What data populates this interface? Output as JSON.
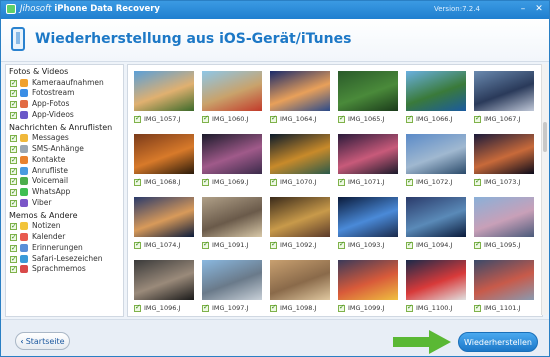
{
  "app": {
    "brand": "Jihosoft",
    "title": "iPhone Data Recovery",
    "version": "Version:7.2.4",
    "window_controls": [
      "minimize-icon",
      "close-icon"
    ]
  },
  "header": {
    "title": "Wiederherstellung aus iOS-Gerät/iTunes",
    "icon": "phone-icon"
  },
  "sidebar": {
    "sections": [
      {
        "label": "Fotos & Videos",
        "items": [
          {
            "label": "Kameraaufnahmen",
            "icon": "camera-roll-icon",
            "color": "#f0a12e"
          },
          {
            "label": "Fotostream",
            "icon": "photostream-icon",
            "color": "#3a8ee6"
          },
          {
            "label": "App-Fotos",
            "icon": "app-photos-icon",
            "color": "#e26b43"
          },
          {
            "label": "App-Videos",
            "icon": "app-videos-icon",
            "color": "#6a58c8"
          }
        ]
      },
      {
        "label": "Nachrichten & Anruflisten",
        "items": [
          {
            "label": "Messages",
            "icon": "messages-icon",
            "color": "#f0b83a"
          },
          {
            "label": "SMS-Anhänge",
            "icon": "sms-attachments-icon",
            "color": "#9aa6b2"
          },
          {
            "label": "Kontakte",
            "icon": "contacts-icon",
            "color": "#e8822f"
          },
          {
            "label": "Anrufliste",
            "icon": "call-log-icon",
            "color": "#4a9be0"
          },
          {
            "label": "Voicemail",
            "icon": "voicemail-icon",
            "color": "#4cae4c"
          },
          {
            "label": "WhatsApp",
            "icon": "whatsapp-icon",
            "color": "#3fbf52"
          },
          {
            "label": "Viber",
            "icon": "viber-icon",
            "color": "#7b57c8"
          }
        ]
      },
      {
        "label": "Memos & Andere",
        "items": [
          {
            "label": "Notizen",
            "icon": "notes-icon",
            "color": "#f2c43a"
          },
          {
            "label": "Kalender",
            "icon": "calendar-icon",
            "color": "#e85a4f"
          },
          {
            "label": "Erinnerungen",
            "icon": "reminders-icon",
            "color": "#5a8fd8"
          },
          {
            "label": "Safari-Lesezeichen",
            "icon": "safari-bookmarks-icon",
            "color": "#3a9ad8"
          },
          {
            "label": "Sprachmemos",
            "icon": "voice-memos-icon",
            "color": "#d84a4a"
          }
        ]
      }
    ]
  },
  "photos": [
    {
      "name": "IMG_1057.J",
      "colors": [
        "#5a9fd8",
        "#e0b070",
        "#3b6a2a"
      ]
    },
    {
      "name": "IMG_1060.J",
      "colors": [
        "#8ec7e8",
        "#c9a26b",
        "#c23a2a"
      ]
    },
    {
      "name": "IMG_1064.J",
      "colors": [
        "#1a2a6a",
        "#e8a05a",
        "#2a4a8a"
      ]
    },
    {
      "name": "IMG_1065.J",
      "colors": [
        "#2a5a2a",
        "#4a8a3a",
        "#1a3a1a"
      ]
    },
    {
      "name": "IMG_1066.J",
      "colors": [
        "#6ab0e0",
        "#3a7a3a",
        "#1a5aa0"
      ]
    },
    {
      "name": "IMG_1067.J",
      "colors": [
        "#6a8ab0",
        "#2a3a5a",
        "#c0c8d8"
      ]
    },
    {
      "name": "IMG_1068.J",
      "colors": [
        "#7a3a1a",
        "#d87a2a",
        "#2a1a0a"
      ]
    },
    {
      "name": "IMG_1069.J",
      "colors": [
        "#1a1a2a",
        "#a05a8a",
        "#3a2a4a"
      ]
    },
    {
      "name": "IMG_1070.J",
      "colors": [
        "#0a1a2a",
        "#c88a2a",
        "#2a5a4a"
      ]
    },
    {
      "name": "IMG_1071.J",
      "colors": [
        "#2a1a3a",
        "#c85a7a",
        "#1a1a2a"
      ]
    },
    {
      "name": "IMG_1072.J",
      "colors": [
        "#5a8ac8",
        "#a0b8d0",
        "#2a4a6a"
      ]
    },
    {
      "name": "IMG_1073.J",
      "colors": [
        "#1a1a3a",
        "#c86a3a",
        "#0a0a1a"
      ]
    },
    {
      "name": "IMG_1074.J",
      "colors": [
        "#2a3a6a",
        "#d89a5a",
        "#0a1a3a"
      ]
    },
    {
      "name": "IMG_1091.J",
      "colors": [
        "#b0a088",
        "#6a5a4a",
        "#d8c8a8"
      ]
    },
    {
      "name": "IMG_1092.J",
      "colors": [
        "#3a2a1a",
        "#c89a4a",
        "#5a3a2a"
      ]
    },
    {
      "name": "IMG_1093.J",
      "colors": [
        "#0a1a3a",
        "#4a8ad8",
        "#1a2a4a"
      ]
    },
    {
      "name": "IMG_1094.J",
      "colors": [
        "#2a3a6a",
        "#5a8ab8",
        "#0a1a3a"
      ]
    },
    {
      "name": "IMG_1095.J",
      "colors": [
        "#8ab0d8",
        "#c8a0b8",
        "#4a5a7a"
      ]
    },
    {
      "name": "IMG_1096.J",
      "colors": [
        "#3a3a3a",
        "#9a8a7a",
        "#1a1a1a"
      ]
    },
    {
      "name": "IMG_1097.J",
      "colors": [
        "#8ab8e0",
        "#6a7a8a",
        "#c8d0d8"
      ]
    },
    {
      "name": "IMG_1098.J",
      "colors": [
        "#c8a070",
        "#8a6a4a",
        "#e0c8a0"
      ]
    },
    {
      "name": "IMG_1099.J",
      "colors": [
        "#3a3a5a",
        "#d85a3a",
        "#f0c040"
      ]
    },
    {
      "name": "IMG_1100.J",
      "colors": [
        "#1a2a4a",
        "#d83a3a",
        "#e0e0e0"
      ]
    },
    {
      "name": "IMG_1101.J",
      "colors": [
        "#3a4a6a",
        "#c85a4a",
        "#8a9ab0"
      ]
    }
  ],
  "footer": {
    "back_label": "Startseite",
    "recover_label": "Wiederherstellen",
    "arrow_color": "#5ab834"
  }
}
